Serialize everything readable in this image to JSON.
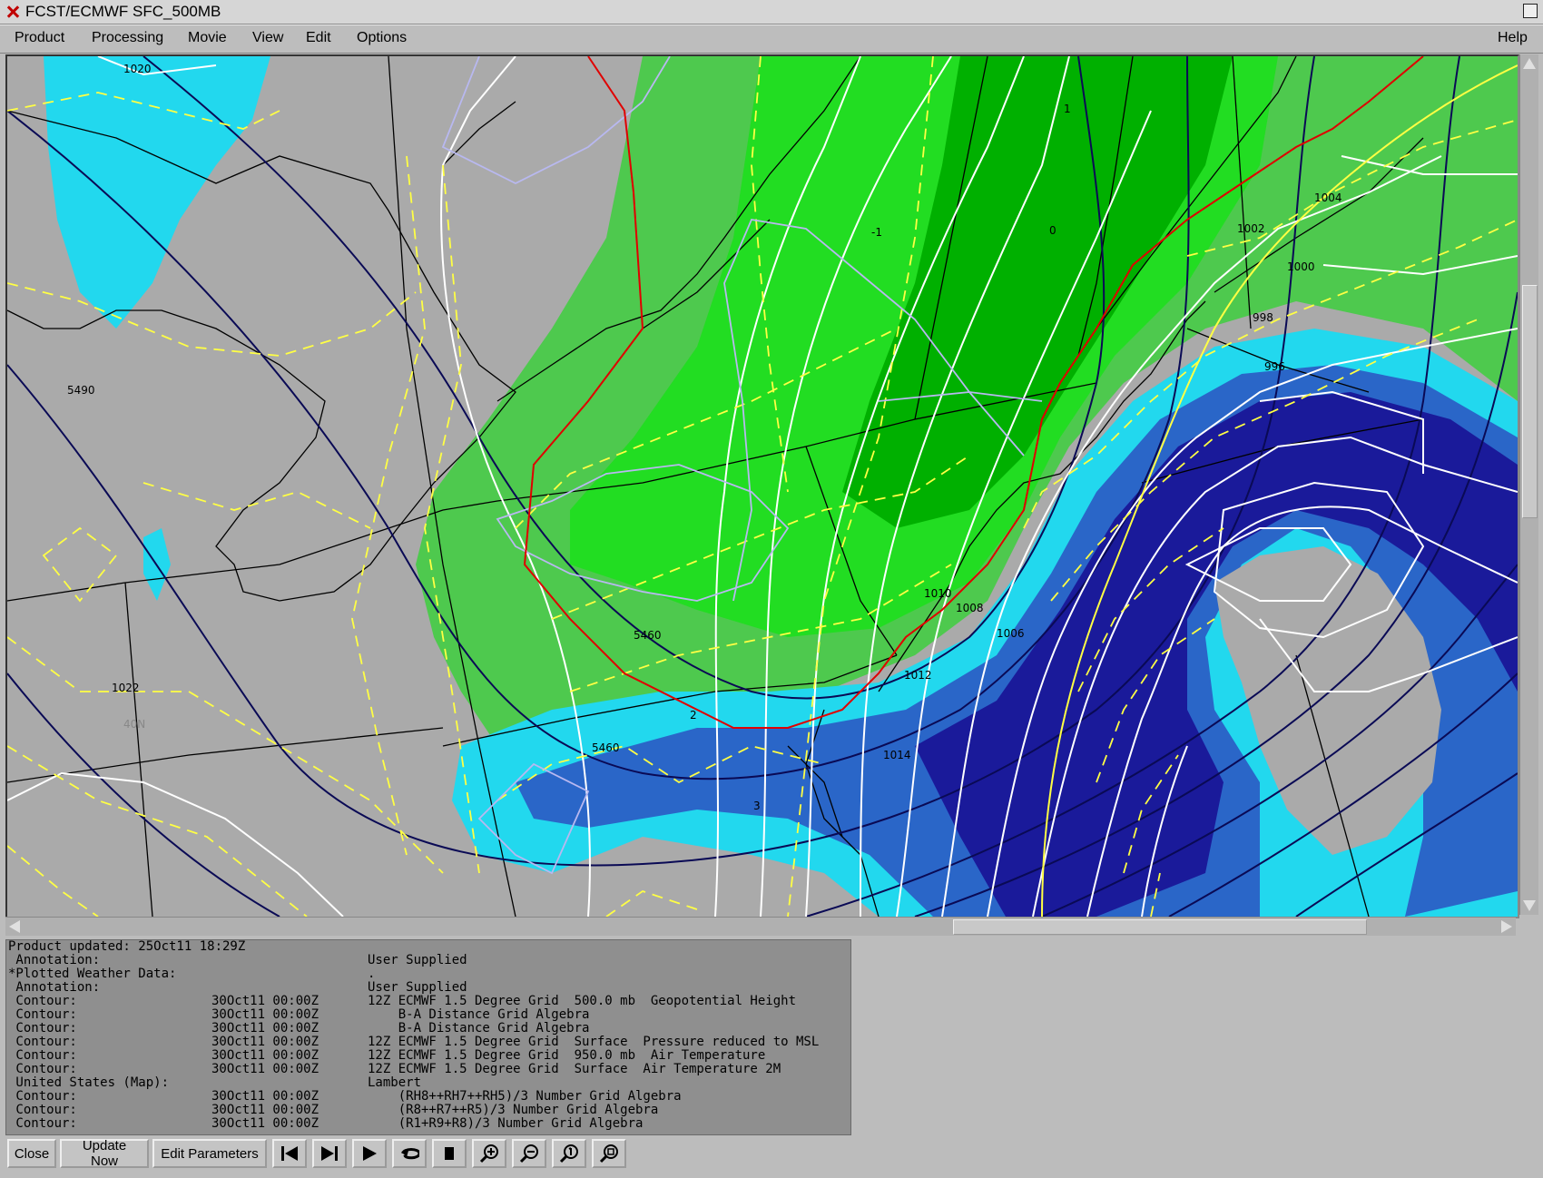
{
  "window": {
    "title": "FCST/ECMWF SFC_500MB"
  },
  "menu": [
    {
      "label": "Product"
    },
    {
      "label": "Processing"
    },
    {
      "label": "Movie"
    },
    {
      "label": "View"
    },
    {
      "label": "Edit"
    },
    {
      "label": "Options"
    }
  ],
  "help_label": "Help",
  "map": {
    "pressure_labels": [
      "1020",
      "1022",
      "1004",
      "1002",
      "1000",
      "998",
      "996",
      "1010",
      "1008",
      "1006",
      "1012",
      "1014"
    ],
    "height_labels": [
      "5490",
      "5460",
      "5460"
    ],
    "temp_labels": [
      "-1",
      "0",
      "1",
      "2",
      "3"
    ],
    "lat_label": "40N",
    "colors": {
      "background": "#aaaaaa",
      "green_light": "#4ec94e",
      "green_mid": "#22dd22",
      "green_dark": "#00b000",
      "cyan": "#22d8ee",
      "blue_mid": "#2a66c8",
      "blue_dark": "#1a1a9a",
      "pressure_contour": "#ffffff",
      "height_contour": "#0a0a55",
      "temp_contour": "#ffff44",
      "freezing_line": "#e00000",
      "lavender": "#b8b8f0"
    }
  },
  "info_panel": {
    "rows": [
      {
        "c1": "Product updated: 25Oct11 18:29Z",
        "c2": "",
        "c3": ""
      },
      {
        "c1": " Annotation:",
        "c2": "",
        "c3": "User Supplied"
      },
      {
        "c1": "*Plotted Weather Data:",
        "c2": "",
        "c3": "."
      },
      {
        "c1": " Annotation:",
        "c2": "",
        "c3": "User Supplied"
      },
      {
        "c1": " Contour:",
        "c2": "30Oct11 00:00Z",
        "c3": "12Z ECMWF 1.5 Degree Grid  500.0 mb  Geopotential Height"
      },
      {
        "c1": " Contour:",
        "c2": "30Oct11 00:00Z",
        "c3": "    B-A Distance Grid Algebra"
      },
      {
        "c1": " Contour:",
        "c2": "30Oct11 00:00Z",
        "c3": "    B-A Distance Grid Algebra"
      },
      {
        "c1": " Contour:",
        "c2": "30Oct11 00:00Z",
        "c3": "12Z ECMWF 1.5 Degree Grid  Surface  Pressure reduced to MSL"
      },
      {
        "c1": " Contour:",
        "c2": "30Oct11 00:00Z",
        "c3": "12Z ECMWF 1.5 Degree Grid  950.0 mb  Air Temperature"
      },
      {
        "c1": " Contour:",
        "c2": "30Oct11 00:00Z",
        "c3": "12Z ECMWF 1.5 Degree Grid  Surface  Air Temperature 2M"
      },
      {
        "c1": " United States (Map):",
        "c2": "",
        "c3": "Lambert"
      },
      {
        "c1": " Contour:",
        "c2": "30Oct11 00:00Z",
        "c3": "    (RH8++RH7++RH5)/3 Number Grid Algebra"
      },
      {
        "c1": " Contour:",
        "c2": "30Oct11 00:00Z",
        "c3": "    (R8++R7++R5)/3 Number Grid Algebra"
      },
      {
        "c1": " Contour:",
        "c2": "30Oct11 00:00Z",
        "c3": "    (R1+R9+R8)/3 Number Grid Algebra"
      }
    ]
  },
  "toolbar": {
    "close_label": "Close",
    "update_label": "Update Now",
    "edit_label": "Edit Parameters"
  }
}
